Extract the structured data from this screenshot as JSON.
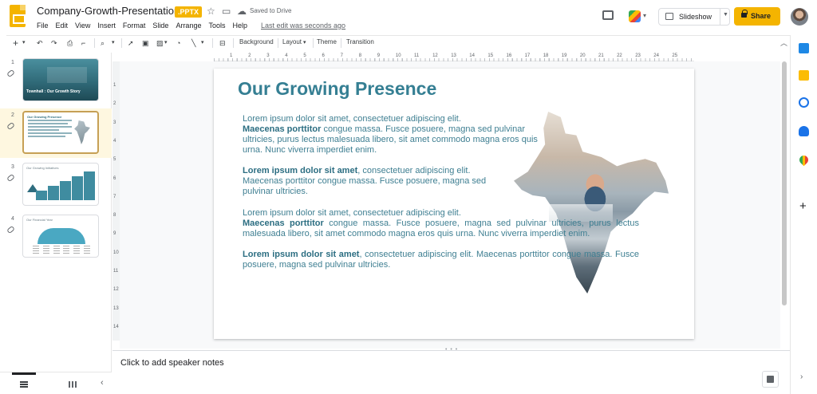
{
  "header": {
    "doc_title": "Company-Growth-Presentation",
    "file_badge": ".PPTX",
    "saved_status": "Saved to Drive",
    "last_edit": "Last edit was seconds ago",
    "menus": [
      "File",
      "Edit",
      "View",
      "Insert",
      "Format",
      "Slide",
      "Arrange",
      "Tools",
      "Help"
    ],
    "slideshow_label": "Slideshow",
    "share_label": "Share"
  },
  "toolbar": {
    "background_label": "Background",
    "layout_label": "Layout",
    "theme_label": "Theme",
    "transition_label": "Transition",
    "icons": [
      "add-icon",
      "undo-icon",
      "redo-icon",
      "print-icon",
      "paint-format-icon",
      "zoom-icon",
      "select-icon",
      "textbox-icon",
      "image-icon",
      "shape-icon",
      "line-icon",
      "comment-icon"
    ]
  },
  "filmstrip": {
    "slides": [
      {
        "number": "1",
        "title": "Townhall : Our Growth Story"
      },
      {
        "number": "2",
        "title": "Our Growing Presence"
      },
      {
        "number": "3",
        "title": "Our Growing Initiatives"
      },
      {
        "number": "4",
        "title": "Our Financial Year"
      }
    ],
    "selected_index": 2
  },
  "rulers": {
    "horizontal": [
      "1",
      "2",
      "3",
      "4",
      "5",
      "6",
      "7",
      "8",
      "9",
      "10",
      "11",
      "12",
      "13",
      "14",
      "15",
      "16",
      "17",
      "18",
      "19",
      "20",
      "21",
      "22",
      "23",
      "24",
      "25"
    ],
    "vertical": [
      "1",
      "2",
      "3",
      "4",
      "5",
      "6",
      "7",
      "8",
      "9",
      "10",
      "11",
      "12",
      "13",
      "14"
    ]
  },
  "slide": {
    "title": "Our Growing Presence",
    "p1_line1": "Lorem ipsum dolor sit amet, consectetuer adipiscing elit.",
    "p1_bold": "Maecenas porttitor",
    "p1_rest": " congue massa. Fusce posuere, magna sed pulvinar ultricies, purus lectus malesuada libero, sit amet commodo magna eros quis urna. Nunc viverra imperdiet enim.",
    "p2_bold": "Lorem ipsum dolor sit amet",
    "p2_rest": ", consectetuer adipiscing elit. Maecenas porttitor congue massa. Fusce posuere, magna sed pulvinar ultricies.",
    "p3_line1": "Lorem ipsum dolor sit amet, consectetuer adipiscing elit.",
    "p3_bold": "Maecenas porttitor",
    "p3_rest": " congue massa. Fusce posuere, magna sed pulvinar ultricies, purus lectus malesuada libero, sit amet commodo magna eros quis urna. Nunc viverra imperdiet enim.",
    "p4_bold": "Lorem ipsum dolor sit amet",
    "p4_rest": ", consectetuer adipiscing elit. Maecenas porttitor congue massa. Fusce posuere, magna sed pulvinar ultricies."
  },
  "notes": {
    "placeholder": "Click to add speaker notes"
  },
  "colors": {
    "accent": "#f4b400",
    "slide_title": "#357f93",
    "slide_text": "#3f7f92"
  }
}
